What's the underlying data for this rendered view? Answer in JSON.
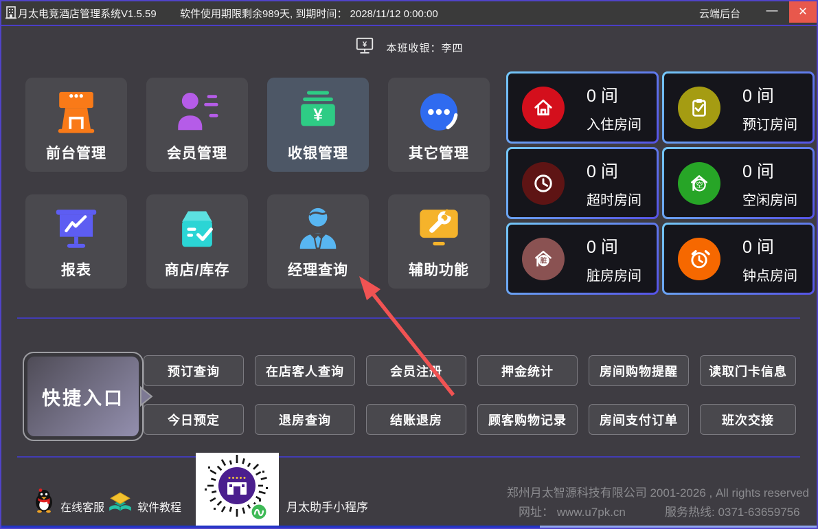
{
  "window": {
    "title": "月太电竞酒店管理系统V1.5.59",
    "license_info": "软件使用期限剩余989天, 到期时间： 2028/11/12 0:00:00",
    "cloud_backend": "云端后台",
    "minimize_label": "—",
    "close_label": "✕"
  },
  "header": {
    "cashier_text": "本班收银：李四"
  },
  "main_tiles": [
    {
      "label": "前台管理",
      "icon": "storefront-icon",
      "color": "#f97a18"
    },
    {
      "label": "会员管理",
      "icon": "member-icon",
      "color": "#b55ce8"
    },
    {
      "label": "收银管理",
      "icon": "cashier-icon",
      "color": "#2ecc85"
    },
    {
      "label": "其它管理",
      "icon": "ellipsis-circle-icon",
      "color": "#2f6bf0"
    },
    {
      "label": "报表",
      "icon": "report-board-icon",
      "color": "#5d5df2"
    },
    {
      "label": "商店/库存",
      "icon": "store-box-icon",
      "color": "#2bd5d5"
    },
    {
      "label": "经理查询",
      "icon": "manager-icon",
      "color": "#58b6f2"
    },
    {
      "label": "辅助功能",
      "icon": "tools-monitor-icon",
      "color": "#f5b32b"
    }
  ],
  "room_status": [
    {
      "count": "0 间",
      "label": "入住房间",
      "icon": "home-icon",
      "color": "#d40f1c"
    },
    {
      "count": "0 间",
      "label": "预订房间",
      "icon": "clipboard-check-icon",
      "color": "#a59c12"
    },
    {
      "count": "0 间",
      "label": "超时房间",
      "icon": "clock-icon",
      "color": "#5e1414"
    },
    {
      "count": "0 间",
      "label": "空闲房间",
      "icon": "vacant-house-icon",
      "glyph": "空",
      "color": "#27a527"
    },
    {
      "count": "0 间",
      "label": "脏房房间",
      "icon": "dirty-house-icon",
      "glyph": "脏",
      "color": "#8a5252"
    },
    {
      "count": "0 间",
      "label": "钟点房间",
      "icon": "alarm-clock-icon",
      "color": "#f66800"
    }
  ],
  "quick_entry": {
    "label": "快捷入口",
    "row1": [
      "预订查询",
      "在店客人查询",
      "会员注册",
      "押金统计",
      "房间购物提醒",
      "读取门卡信息"
    ],
    "row2": [
      "今日预定",
      "退房查询",
      "结账退房",
      "顾客购物记录",
      "房间支付订单",
      "班次交接"
    ]
  },
  "footer": {
    "online_service": "在线客服",
    "tutorial": "软件教程",
    "miniprogram": "月太助手小程序",
    "company_line": "郑州月太智源科技有限公司 2001-2026 , All rights reserved",
    "website": "网址： www.u7pk.cn",
    "hotline": "服务热线: 0371-63659756"
  },
  "accent_colors": {
    "window_border": "#5144c8",
    "status_border_gradient": [
      "#74c8f8",
      "#5552e6"
    ],
    "divider": "#423cb5",
    "close_button": "#e8584c",
    "arrow": "#f15353"
  }
}
